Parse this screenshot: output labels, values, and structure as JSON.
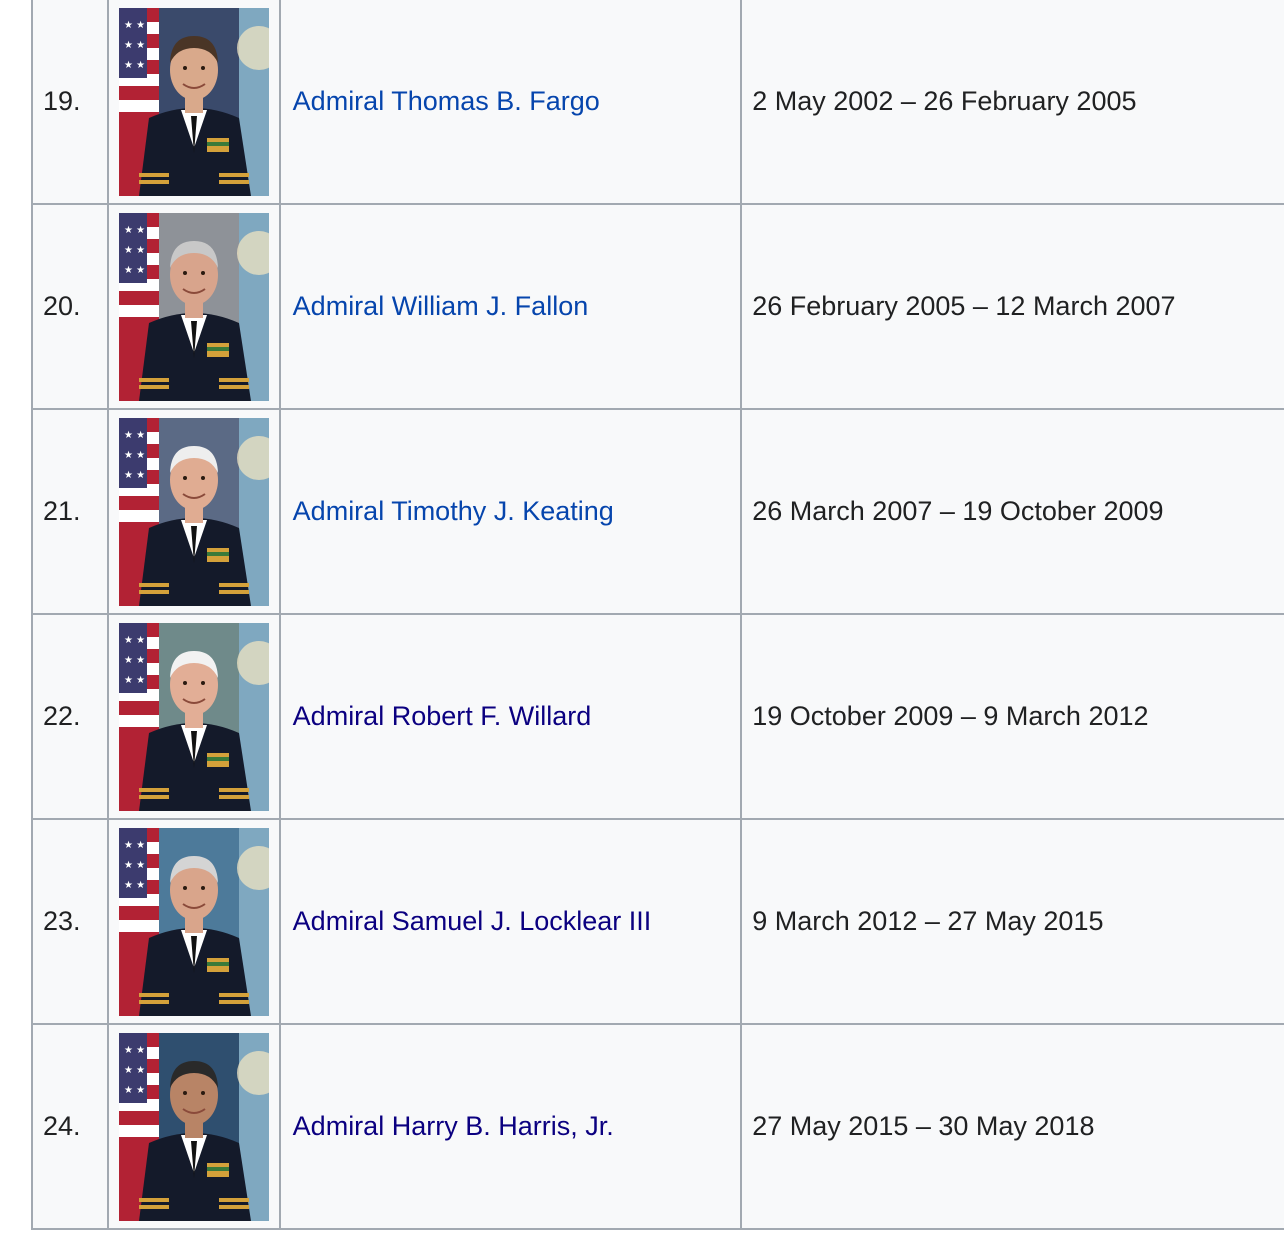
{
  "rows": [
    {
      "number": "19.",
      "name": "Admiral Thomas B. Fargo",
      "term": "2 May 2002 – 26 February 2005",
      "link_state": "unvisited",
      "photo_bg": "#3a4a6b",
      "hair": "#4a3526",
      "skin": "#d9a98b"
    },
    {
      "number": "20.",
      "name": "Admiral William J. Fallon",
      "term": "26 February 2005 – 12 March 2007",
      "link_state": "unvisited",
      "photo_bg": "#8e9298",
      "hair": "#c8c8c8",
      "skin": "#d8a48c"
    },
    {
      "number": "21.",
      "name": "Admiral Timothy J. Keating",
      "term": "26 March 2007 – 19 October 2009",
      "link_state": "unvisited",
      "photo_bg": "#5b6a85",
      "hair": "#eeeeee",
      "skin": "#e0ac92"
    },
    {
      "number": "22.",
      "name": "Admiral Robert F. Willard",
      "term": "19 October 2009 – 9 March 2012",
      "link_state": "visited",
      "photo_bg": "#6f8a8a",
      "hair": "#f2f2f2",
      "skin": "#e2ae96"
    },
    {
      "number": "23.",
      "name": "Admiral Samuel J. Locklear III",
      "term": "9 March 2012 – 27 May 2015",
      "link_state": "visited",
      "photo_bg": "#4d7a9a",
      "hair": "#d4d4d4",
      "skin": "#d9a58b"
    },
    {
      "number": "24.",
      "name": "Admiral Harry B. Harris, Jr.",
      "term": "27 May 2015 – 30 May 2018",
      "link_state": "visited",
      "photo_bg": "#2f4f6f",
      "hair": "#2a2a2a",
      "skin": "#b88466"
    }
  ],
  "colors": {
    "link_visited": "#0b0080",
    "link_unvisited": "#0645ad",
    "table_bg": "#f8f9fa",
    "border": "#a2a9b1",
    "text": "#202122"
  }
}
